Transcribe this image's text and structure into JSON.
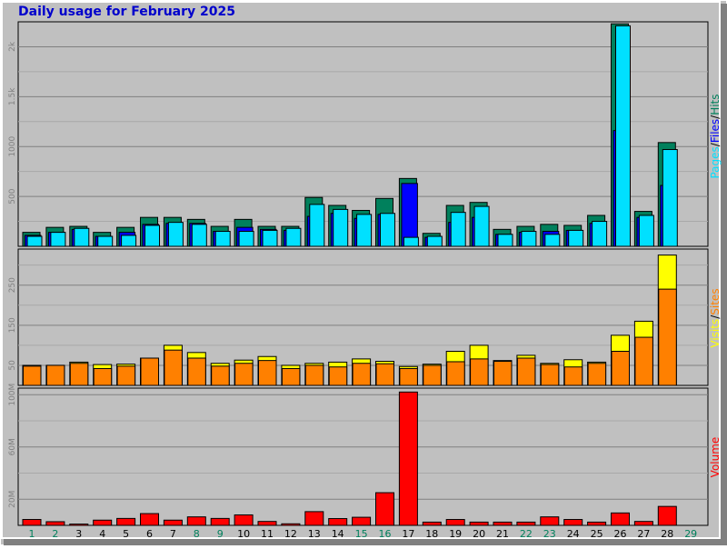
{
  "title": "Daily usage for February 2025",
  "colors": {
    "hits": "#00805c",
    "files": "#0000ff",
    "pages": "#00e0ff",
    "visits": "#ffff00",
    "sites": "#ff8000",
    "volume": "#ff0000",
    "weekend_day": "#00805c",
    "weekday_day": "#000000",
    "panel_bg": "#c0c0c0"
  },
  "legend": {
    "top": [
      {
        "text": "Pages",
        "color": "#00e0ff"
      },
      {
        "text": "/",
        "color": "#000000"
      },
      {
        "text": "Files",
        "color": "#0000ff"
      },
      {
        "text": "/",
        "color": "#000000"
      },
      {
        "text": "Hits",
        "color": "#00805c"
      }
    ],
    "middle": [
      {
        "text": "Visits",
        "color": "#ffff00"
      },
      {
        "text": "/",
        "color": "#000000"
      },
      {
        "text": "Sites",
        "color": "#ff8000"
      }
    ],
    "bottom": [
      {
        "text": "Volume",
        "color": "#ff0000"
      }
    ]
  },
  "chart_data": [
    {
      "type": "bar",
      "panel": "hits-files-pages",
      "categories": [
        "1",
        "2",
        "3",
        "4",
        "5",
        "6",
        "7",
        "8",
        "9",
        "10",
        "11",
        "12",
        "13",
        "14",
        "15",
        "16",
        "17",
        "18",
        "19",
        "20",
        "21",
        "22",
        "23",
        "24",
        "25",
        "26",
        "27",
        "28",
        "29"
      ],
      "weekend": [
        true,
        true,
        false,
        false,
        false,
        false,
        false,
        true,
        true,
        false,
        false,
        false,
        false,
        false,
        true,
        true,
        false,
        false,
        false,
        false,
        false,
        true,
        true,
        false,
        false,
        false,
        false,
        false,
        true
      ],
      "yticks": [
        "500",
        "1000",
        "1.5k",
        "2k"
      ],
      "yvalues": [
        500,
        1000,
        1500,
        2000
      ],
      "ylim": [
        0,
        2250
      ],
      "series": [
        {
          "name": "Hits",
          "values": [
            140,
            190,
            200,
            140,
            190,
            290,
            290,
            270,
            200,
            270,
            200,
            200,
            490,
            410,
            360,
            480,
            680,
            130,
            410,
            440,
            170,
            200,
            220,
            210,
            310,
            2230,
            350,
            1040,
            0
          ]
        },
        {
          "name": "Files",
          "values": [
            110,
            140,
            170,
            100,
            140,
            220,
            230,
            230,
            150,
            190,
            170,
            160,
            300,
            330,
            280,
            320,
            630,
            90,
            240,
            290,
            120,
            140,
            150,
            160,
            230,
            1160,
            290,
            610,
            0
          ]
        },
        {
          "name": "Pages",
          "values": [
            100,
            140,
            180,
            100,
            110,
            210,
            240,
            220,
            150,
            150,
            160,
            180,
            420,
            370,
            320,
            330,
            90,
            100,
            340,
            400,
            120,
            150,
            120,
            160,
            250,
            2210,
            310,
            970,
            0
          ]
        }
      ]
    },
    {
      "type": "bar",
      "panel": "visits-sites",
      "categories": [
        "1",
        "2",
        "3",
        "4",
        "5",
        "6",
        "7",
        "8",
        "9",
        "10",
        "11",
        "12",
        "13",
        "14",
        "15",
        "16",
        "17",
        "18",
        "19",
        "20",
        "21",
        "22",
        "23",
        "24",
        "25",
        "26",
        "27",
        "28",
        "29"
      ],
      "yticks": [
        "50",
        "150",
        "250"
      ],
      "yvalues": [
        50,
        150,
        250
      ],
      "ylim": [
        0,
        340
      ],
      "series": [
        {
          "name": "Visits",
          "values": [
            50,
            50,
            58,
            52,
            53,
            68,
            100,
            82,
            55,
            63,
            72,
            50,
            55,
            58,
            66,
            60,
            47,
            53,
            85,
            100,
            62,
            75,
            55,
            64,
            58,
            125,
            160,
            325,
            0
          ]
        },
        {
          "name": "Sites",
          "values": [
            48,
            50,
            55,
            42,
            48,
            68,
            88,
            68,
            48,
            55,
            62,
            42,
            50,
            46,
            55,
            54,
            42,
            50,
            59,
            66,
            60,
            68,
            52,
            46,
            55,
            85,
            120,
            240,
            0
          ]
        }
      ]
    },
    {
      "type": "bar",
      "panel": "volume",
      "categories": [
        "1",
        "2",
        "3",
        "4",
        "5",
        "6",
        "7",
        "8",
        "9",
        "10",
        "11",
        "12",
        "13",
        "14",
        "15",
        "16",
        "17",
        "18",
        "19",
        "20",
        "21",
        "22",
        "23",
        "24",
        "25",
        "26",
        "27",
        "28",
        "29"
      ],
      "yticks": [
        "20M",
        "60M",
        "100M"
      ],
      "yvalues": [
        20,
        60,
        100
      ],
      "ylim": [
        0,
        105
      ],
      "unit": "MB",
      "series": [
        {
          "name": "Volume",
          "values": [
            4.5,
            2.8,
            1,
            4,
            5.3,
            9,
            4,
            6.5,
            5.3,
            8,
            3,
            1.2,
            10.5,
            5.2,
            6.2,
            25,
            102,
            2.5,
            4.5,
            2.5,
            2.5,
            2.5,
            6.5,
            4.5,
            2.5,
            9.5,
            3,
            14.5,
            0
          ]
        }
      ]
    }
  ]
}
